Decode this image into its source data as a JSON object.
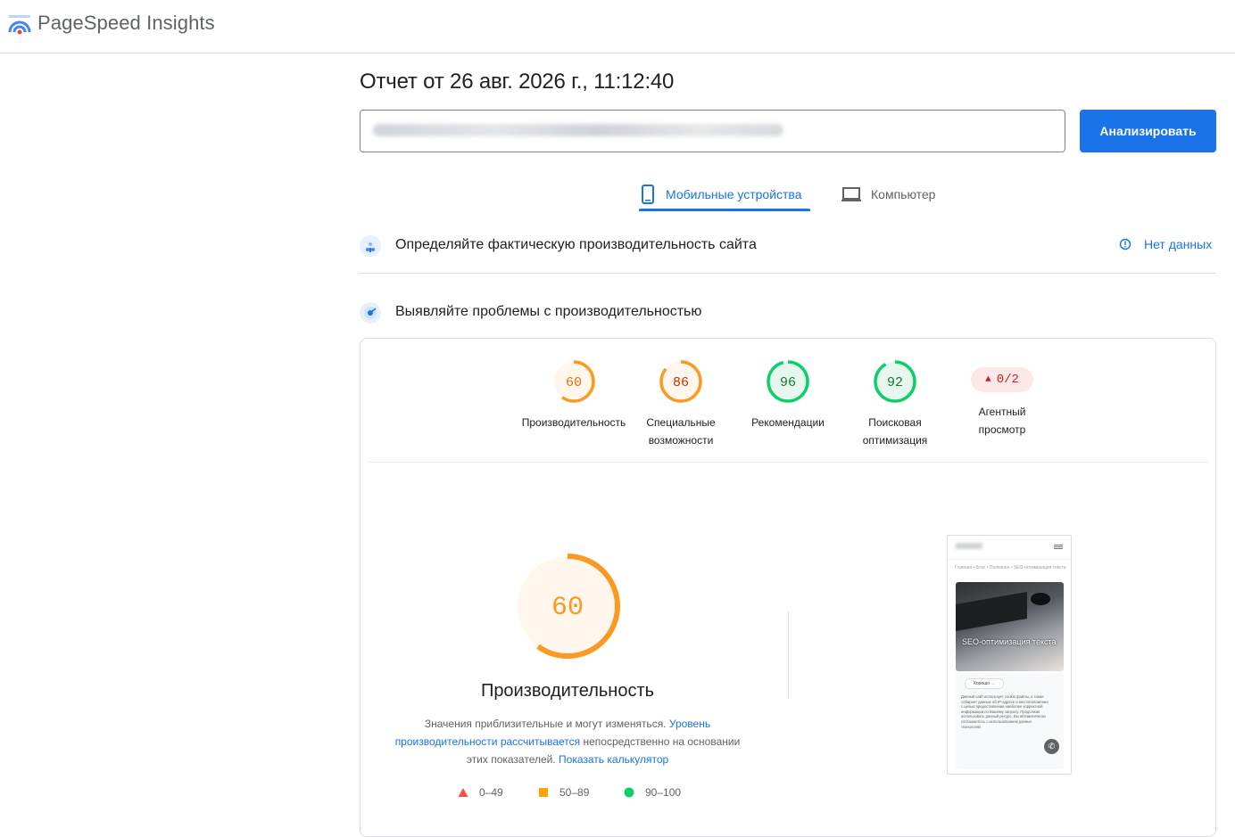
{
  "app": {
    "title": "PageSpeed Insights"
  },
  "report": {
    "title": "Отчет от 26 авг. 2026 г., 11:12:40",
    "url_value": "",
    "analyze_label": "Анализировать"
  },
  "tabs": [
    {
      "label": "Мобильные устройства",
      "icon": "smartphone-icon",
      "active": true
    },
    {
      "label": "Компьютер",
      "icon": "laptop-icon",
      "active": false
    }
  ],
  "sections": {
    "field": {
      "title": "Определяйте фактическую производительность сайта",
      "status": "Нет данных"
    },
    "lab": {
      "title": "Выявляйте проблемы с производительностью"
    }
  },
  "scores": [
    {
      "key": "performance",
      "value": "60",
      "label_line1": "Производительность",
      "label_line2": "",
      "color": "#e8710a",
      "ring": "#fa9a22",
      "fill": "#fff7ed"
    },
    {
      "key": "accessibility",
      "value": "86",
      "label_line1": "Специальные",
      "label_line2": "возможности",
      "color": "#c33300",
      "ring": "#fa9a22",
      "fill": "#fff7ed"
    },
    {
      "key": "best-practices",
      "value": "96",
      "label_line1": "Рекомендации",
      "label_line2": "",
      "color": "#0d7a3a",
      "ring": "#0cce6b",
      "fill": "#e8f7ee"
    },
    {
      "key": "seo",
      "value": "92",
      "label_line1": "Поисковая",
      "label_line2": "оптимизация",
      "color": "#0d7a3a",
      "ring": "#0cce6b",
      "fill": "#e8f7ee"
    }
  ],
  "agent": {
    "value": "0/2",
    "label_line1": "Агентный",
    "label_line2": "просмотр"
  },
  "performance": {
    "score": "60",
    "score_fraction": 0.6,
    "title": "Производительность",
    "desc_part1": "Значения приблизительные и могут изменяться.",
    "desc_link1": "Уровень производительности рассчитывается",
    "desc_part2": "непосредственно на основании этих показателей.",
    "desc_link2": "Показать калькулятор"
  },
  "legend": [
    {
      "range": "0–49",
      "shape": "triangle",
      "color": "#ff4e42"
    },
    {
      "range": "50–89",
      "shape": "square",
      "color": "#ffa400"
    },
    {
      "range": "90–100",
      "shape": "circle",
      "color": "#0cce6b"
    }
  ],
  "screenshot": {
    "breadcrumb": "Главная • Блог • Полезное • SEO-оптимизация текста",
    "hero_title": "SEO-оптимизация текста",
    "cookie_button": "Хорошо",
    "cookie_text": "Данный сайт использует cookie файлы, а также собирает данные об IP-адресе и местоположении с целью предоставления наиболее корректной информации по Вашему запросу. Продолжая использовать данный ресурс, Вы автоматически соглашаетесь с использованием данных технологий."
  },
  "colors": {
    "accent": "#1a73e8",
    "average": "#fa9a22",
    "pass": "#0cce6b",
    "fail": "#ff4e42"
  }
}
